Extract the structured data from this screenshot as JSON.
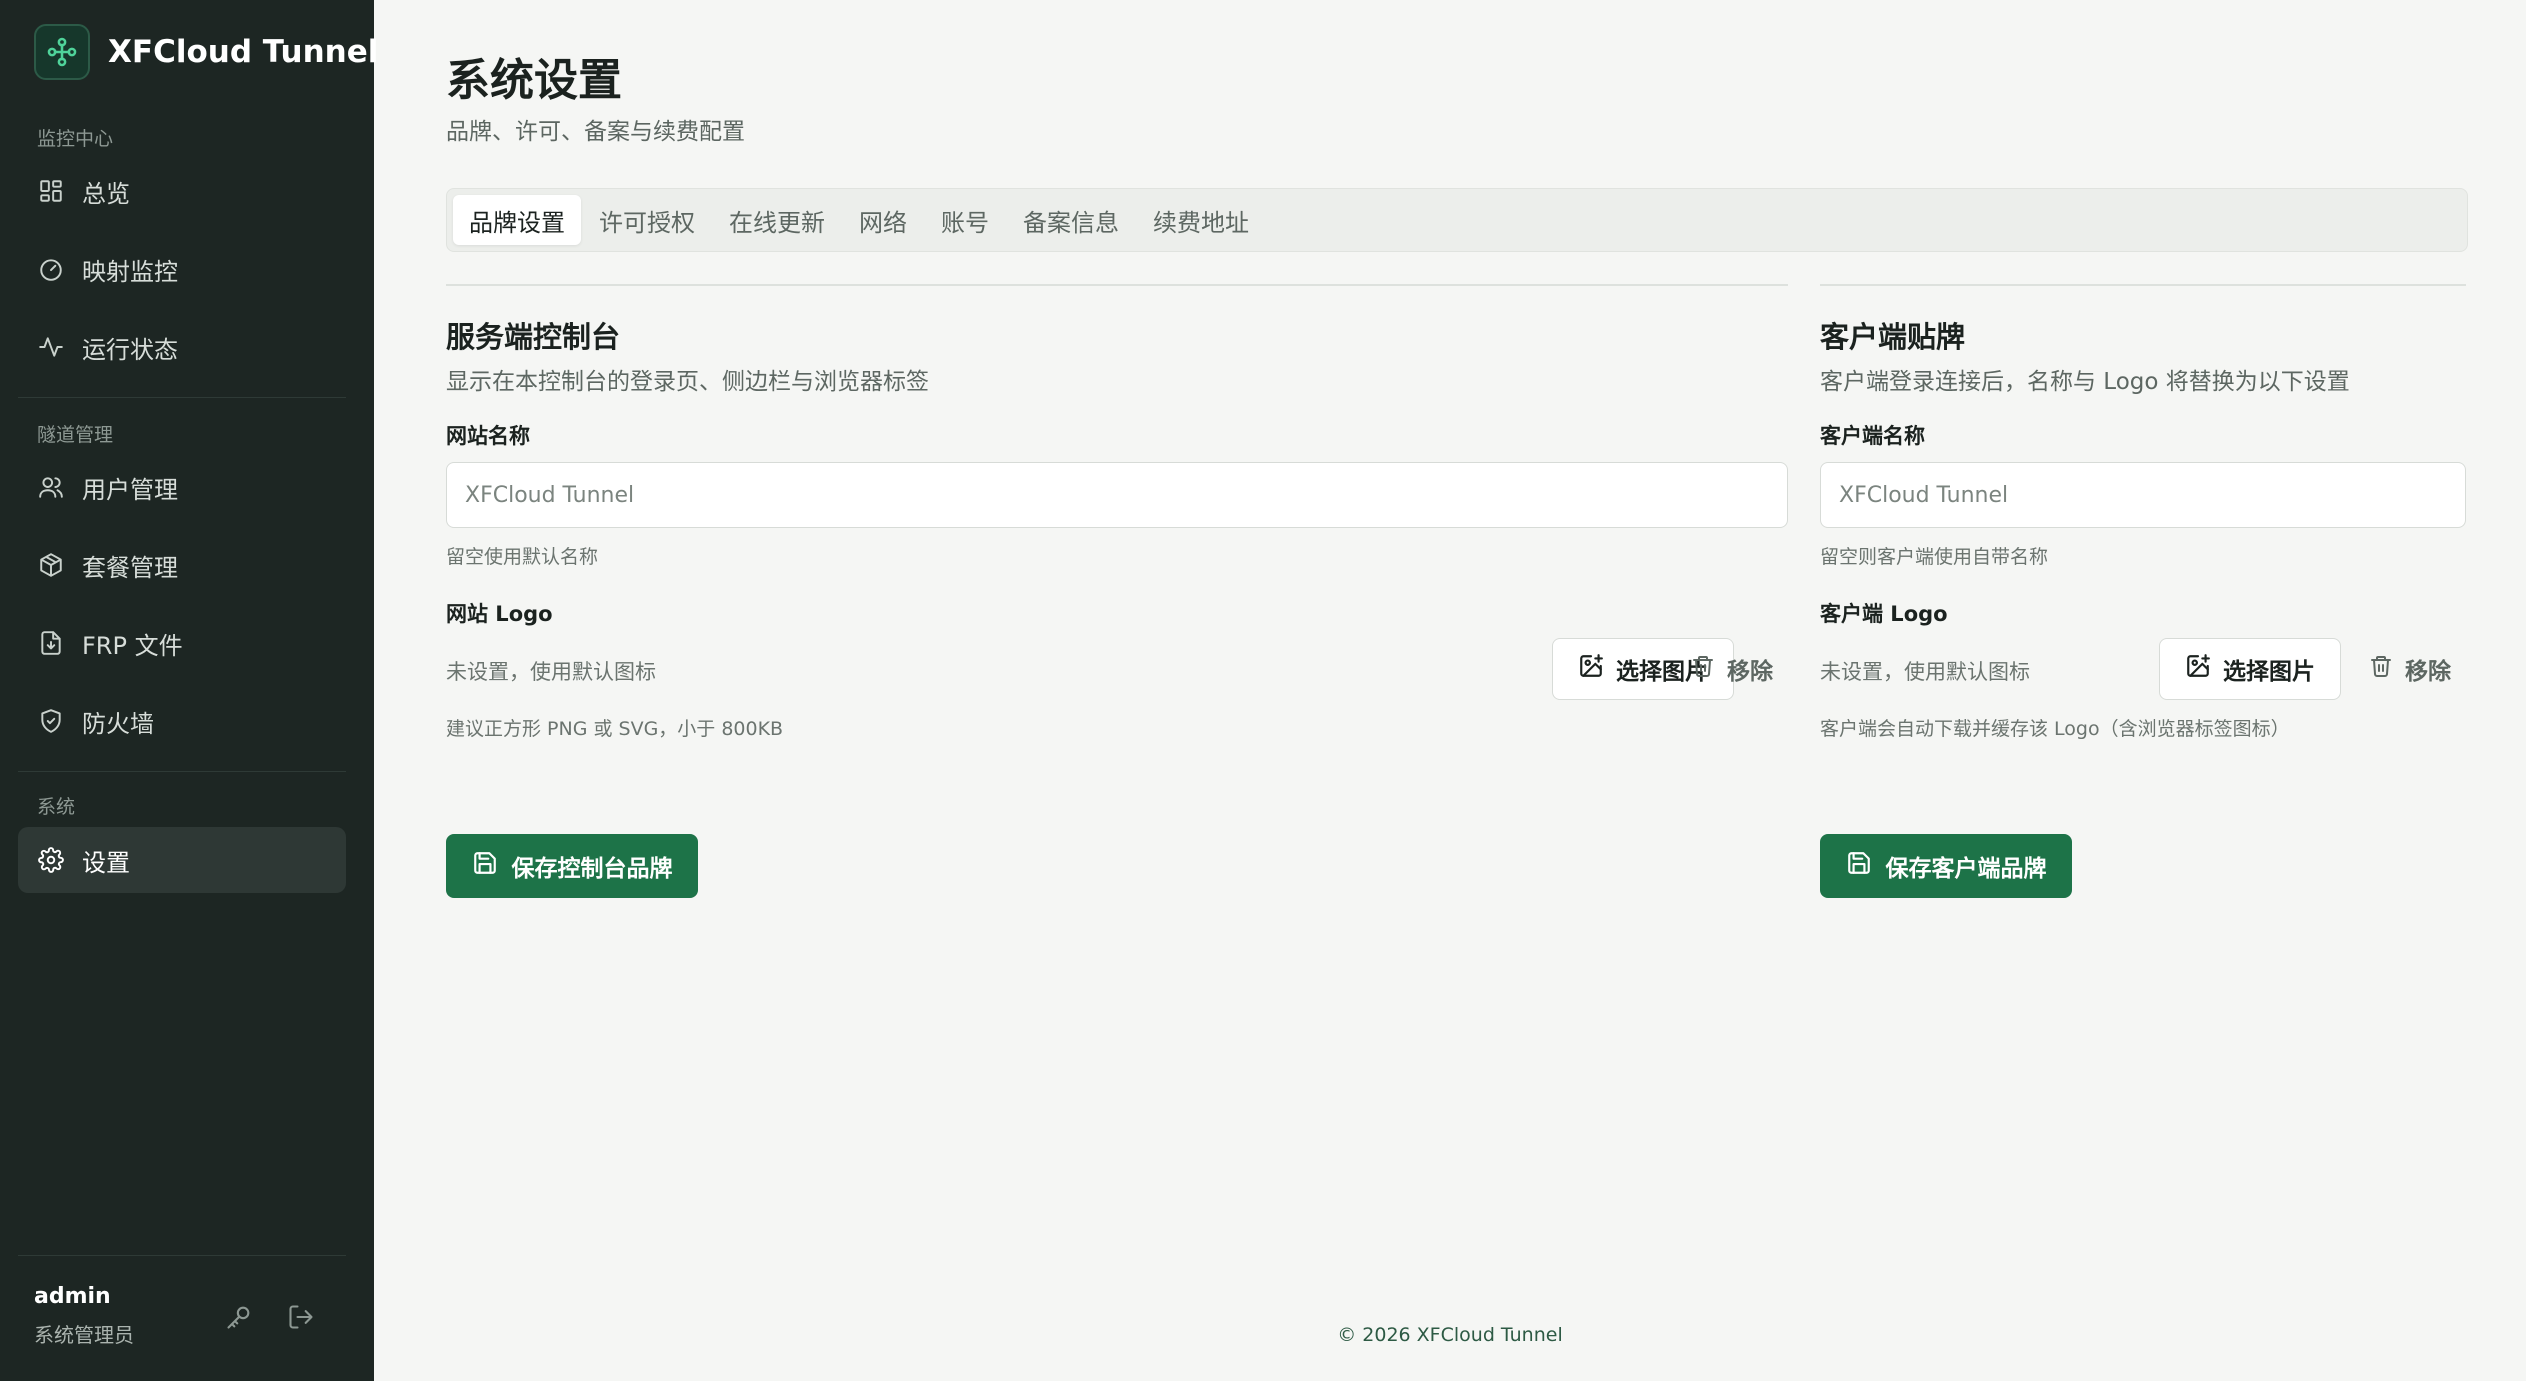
{
  "sidebar": {
    "brand_name": "XFCloud Tunnel",
    "sections": {
      "monitor": "监控中心",
      "tunnel": "隧道管理",
      "system": "系统"
    },
    "items": {
      "overview": "总览",
      "mapping": "映射监控",
      "status": "运行状态",
      "users": "用户管理",
      "plans": "套餐管理",
      "frp": "FRP 文件",
      "firewall": "防火墙",
      "settings": "设置"
    },
    "user": {
      "name": "admin",
      "role": "系统管理员"
    }
  },
  "page": {
    "title": "系统设置",
    "subtitle": "品牌、许可、备案与续费配置"
  },
  "tabs": [
    "品牌设置",
    "许可授权",
    "在线更新",
    "网络",
    "账号",
    "备案信息",
    "续费地址"
  ],
  "server_panel": {
    "title": "服务端控制台",
    "desc": "显示在本控制台的登录页、侧边栏与浏览器标签",
    "name_label": "网站名称",
    "name_placeholder": "XFCloud Tunnel",
    "name_hint": "留空使用默认名称",
    "logo_label": "网站 Logo",
    "logo_status": "未设置，使用默认图标",
    "pick_label": "选择图片",
    "remove_label": "移除",
    "logo_hint": "建议正方形 PNG 或 SVG，小于 800KB",
    "save_label": "保存控制台品牌"
  },
  "client_panel": {
    "title": "客户端贴牌",
    "desc": "客户端登录连接后，名称与 Logo 将替换为以下设置",
    "name_label": "客户端名称",
    "name_placeholder": "XFCloud Tunnel",
    "name_hint": "留空则客户端使用自带名称",
    "logo_label": "客户端 Logo",
    "logo_status": "未设置，使用默认图标",
    "pick_label": "选择图片",
    "remove_label": "移除",
    "logo_hint": "客户端会自动下载并缓存该 Logo（含浏览器标签图标）",
    "save_label": "保存客户端品牌"
  },
  "footer": "© 2026 XFCloud Tunnel",
  "colors": {
    "sidebar_bg": "#1d2623",
    "accent": "#1d7348",
    "brand_icon": "#4fd39a"
  }
}
